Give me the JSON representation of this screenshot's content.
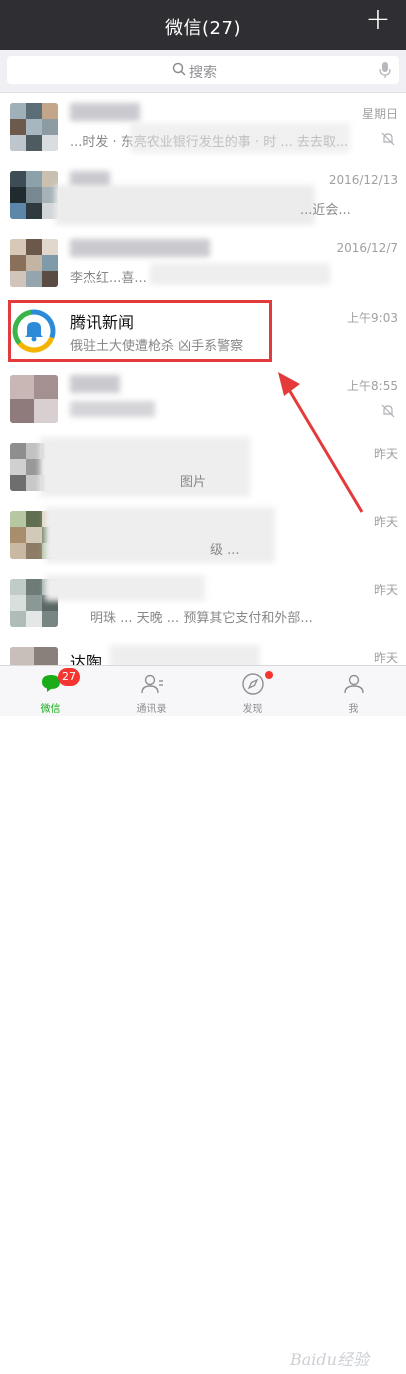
{
  "header": {
    "title": "微信(27)",
    "plus_label": "+"
  },
  "search": {
    "placeholder": "搜索"
  },
  "chats": [
    {
      "name": "",
      "preview": "...时发 · 东亮农业银行发生的事 · 时 ... 去去取...",
      "time": "星期日",
      "muted": true
    },
    {
      "name": "",
      "preview": "...近会...",
      "time": "2016/12/13",
      "muted": false
    },
    {
      "name": "",
      "preview": "李杰红...喜...",
      "time": "2016/12/7",
      "muted": false
    },
    {
      "name": "腾讯新闻",
      "preview": "俄驻土大使遭枪杀 凶手系警察",
      "time": "上午9:03",
      "muted": false
    },
    {
      "name": "",
      "preview": "",
      "time": "上午8:55",
      "muted": true
    },
    {
      "name": "",
      "preview": "图片",
      "time": "昨天",
      "muted": false
    },
    {
      "name": "",
      "preview": "级 ...",
      "time": "昨天",
      "muted": false
    },
    {
      "name": "",
      "preview": "明珠 ... 天晚 ... 预算其它支付和外部...",
      "time": "昨天",
      "muted": false
    },
    {
      "name": "达陶",
      "preview": "",
      "time": "昨天",
      "muted": false
    }
  ],
  "tabbar": {
    "tabs": [
      {
        "label": "微信",
        "icon": "chat-bubble-icon",
        "badge": "27",
        "active": true
      },
      {
        "label": "通讯录",
        "icon": "contacts-icon"
      },
      {
        "label": "发现",
        "icon": "compass-icon",
        "dot": true
      },
      {
        "label": "我",
        "icon": "person-icon"
      }
    ]
  },
  "colors": {
    "header_bg": "#2f2f33",
    "accent_green": "#1aad19",
    "highlight_red": "#e33b3b",
    "badge_red": "#f43531"
  },
  "watermark": {
    "text": "Baidu经验"
  }
}
